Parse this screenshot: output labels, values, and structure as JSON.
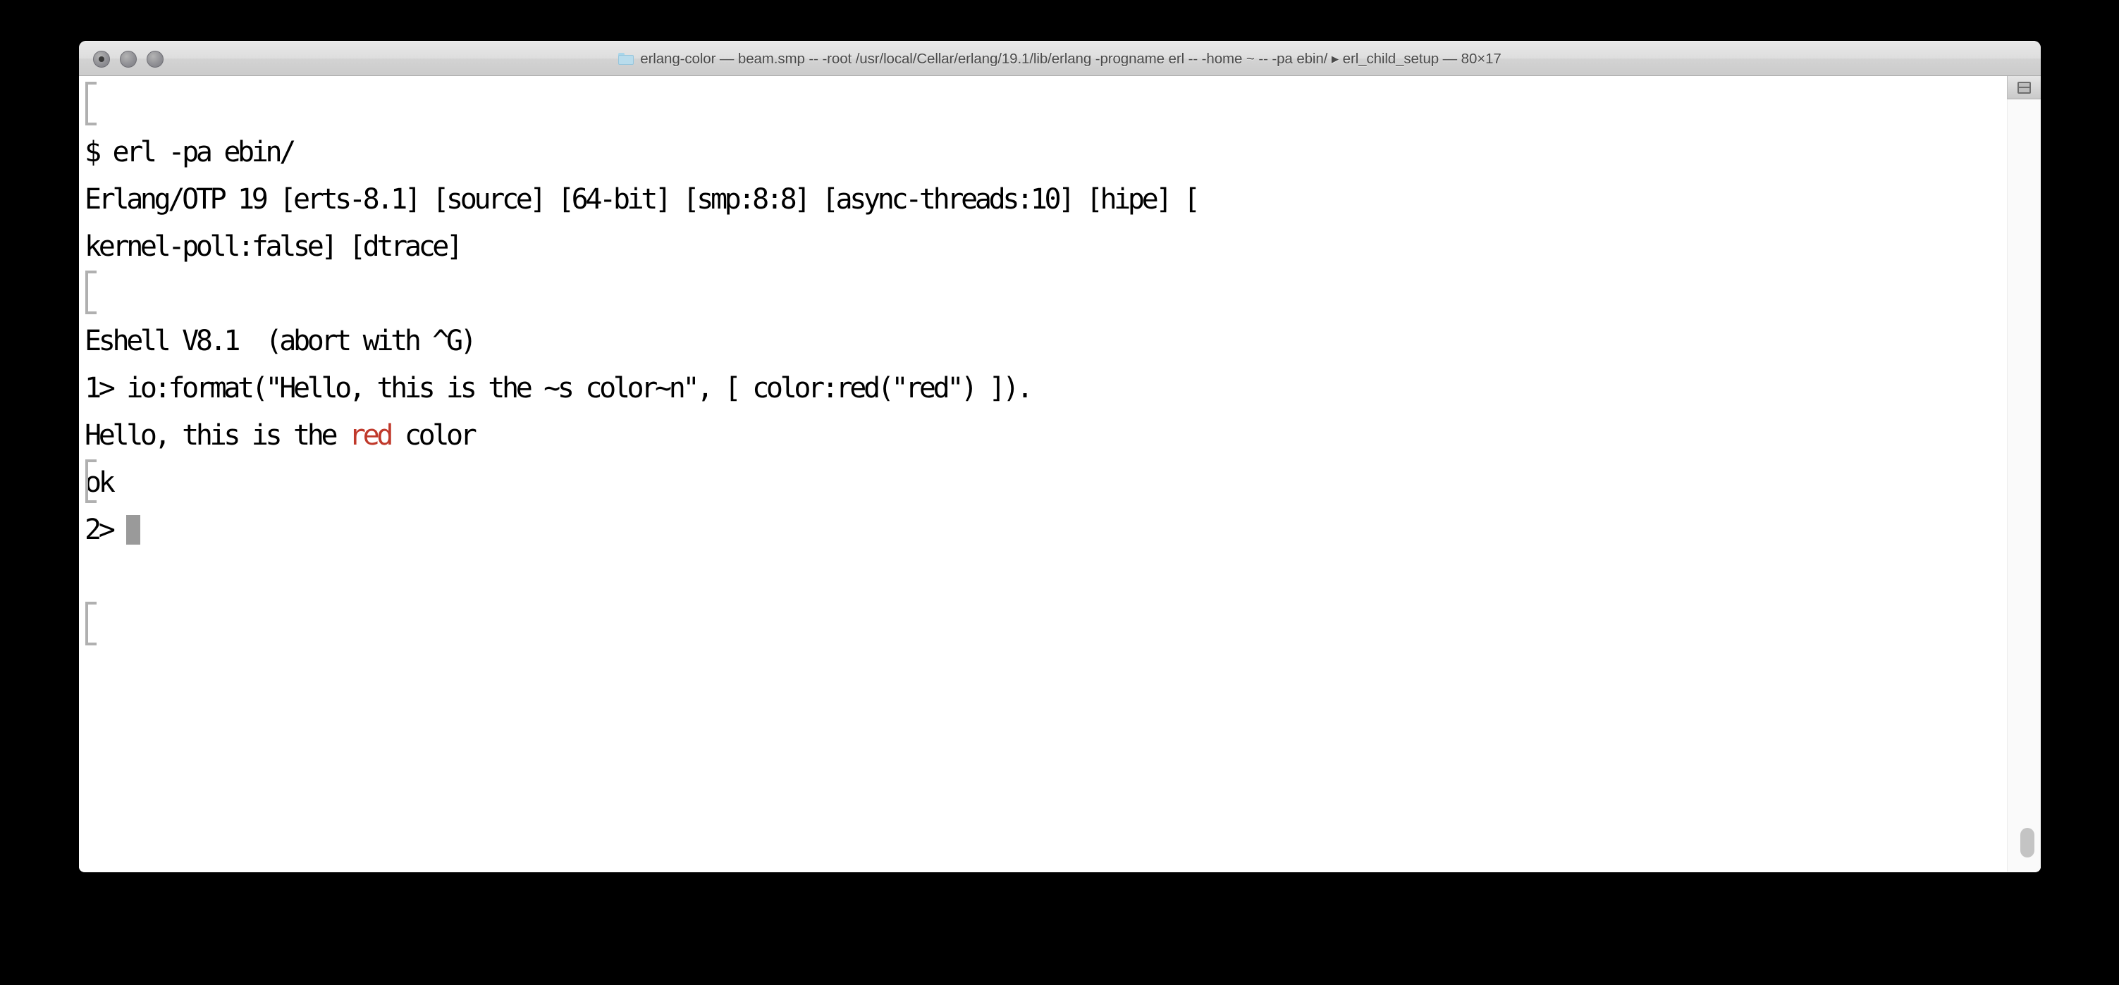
{
  "window": {
    "title": "erlang-color — beam.smp -- -root /usr/local/Cellar/erlang/19.1/lib/erlang -progname erl -- -home ~ -- -pa ebin/ ▸ erl_child_setup — 80×17",
    "folder_icon": "folder-icon",
    "traffic_lights": [
      {
        "name": "close-button",
        "label": "Close"
      },
      {
        "name": "minimize-button",
        "label": "Minimize"
      },
      {
        "name": "zoom-button",
        "label": "Zoom"
      }
    ],
    "size_label": "80×17",
    "app": "Terminal"
  },
  "colors": {
    "background": "#ffffff",
    "foreground": "#000000",
    "ansi_red": "#c0392b",
    "cursor": "#9a9a9a",
    "titlebar": "#d6d6d6",
    "desktop": "#000000"
  },
  "terminal": {
    "lines": [
      {
        "id": "blank-0",
        "text": " "
      },
      {
        "id": "shell-command",
        "text": "$ erl -pa ebin/"
      },
      {
        "id": "otp-banner-1",
        "text": "Erlang/OTP 19 [erts-8.1] [source] [64-bit] [smp:8:8] [async-threads:10] [hipe] ["
      },
      {
        "id": "otp-banner-2",
        "text": "kernel-poll:false] [dtrace]"
      },
      {
        "id": "blank-1",
        "text": " "
      },
      {
        "id": "eshell-banner",
        "text": "Eshell V8.1  (abort with ^G)"
      },
      {
        "id": "prompt-1",
        "text": "1> io:format(\"Hello, this is the ~s color~n\", [ color:red(\"red\") ])."
      },
      {
        "id": "output-hello-pre",
        "text": "Hello, this is the "
      },
      {
        "id": "output-hello-red",
        "text": "red"
      },
      {
        "id": "output-hello-post",
        "text": " color"
      },
      {
        "id": "result-ok",
        "text": "ok"
      },
      {
        "id": "prompt-2",
        "text": "2> "
      }
    ],
    "cursor": {
      "name": "text-cursor",
      "shape": "block",
      "row": 11,
      "column": 4
    }
  },
  "controls": {
    "split_pane": "split-pane-button",
    "scrollbar": "vertical-scrollbar"
  }
}
